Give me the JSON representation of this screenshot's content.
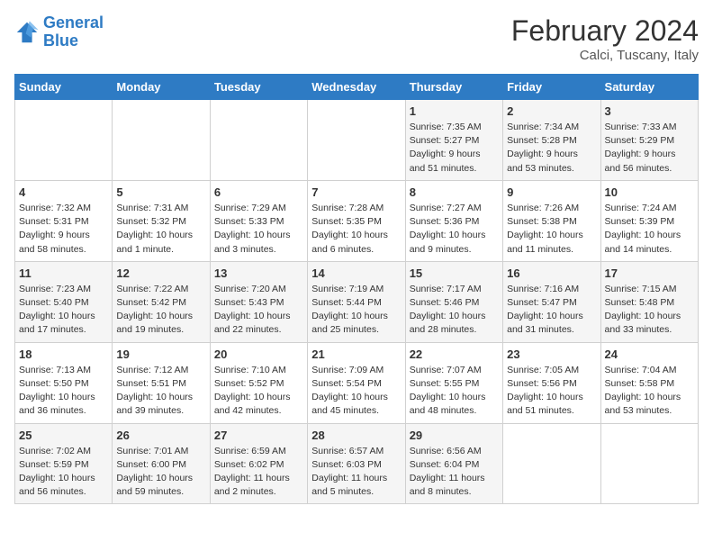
{
  "logo": {
    "line1": "General",
    "line2": "Blue"
  },
  "title": "February 2024",
  "subtitle": "Calci, Tuscany, Italy",
  "days_header": [
    "Sunday",
    "Monday",
    "Tuesday",
    "Wednesday",
    "Thursday",
    "Friday",
    "Saturday"
  ],
  "weeks": [
    [
      {
        "day": "",
        "info": ""
      },
      {
        "day": "",
        "info": ""
      },
      {
        "day": "",
        "info": ""
      },
      {
        "day": "",
        "info": ""
      },
      {
        "day": "1",
        "info": "Sunrise: 7:35 AM\nSunset: 5:27 PM\nDaylight: 9 hours\nand 51 minutes."
      },
      {
        "day": "2",
        "info": "Sunrise: 7:34 AM\nSunset: 5:28 PM\nDaylight: 9 hours\nand 53 minutes."
      },
      {
        "day": "3",
        "info": "Sunrise: 7:33 AM\nSunset: 5:29 PM\nDaylight: 9 hours\nand 56 minutes."
      }
    ],
    [
      {
        "day": "4",
        "info": "Sunrise: 7:32 AM\nSunset: 5:31 PM\nDaylight: 9 hours\nand 58 minutes."
      },
      {
        "day": "5",
        "info": "Sunrise: 7:31 AM\nSunset: 5:32 PM\nDaylight: 10 hours\nand 1 minute."
      },
      {
        "day": "6",
        "info": "Sunrise: 7:29 AM\nSunset: 5:33 PM\nDaylight: 10 hours\nand 3 minutes."
      },
      {
        "day": "7",
        "info": "Sunrise: 7:28 AM\nSunset: 5:35 PM\nDaylight: 10 hours\nand 6 minutes."
      },
      {
        "day": "8",
        "info": "Sunrise: 7:27 AM\nSunset: 5:36 PM\nDaylight: 10 hours\nand 9 minutes."
      },
      {
        "day": "9",
        "info": "Sunrise: 7:26 AM\nSunset: 5:38 PM\nDaylight: 10 hours\nand 11 minutes."
      },
      {
        "day": "10",
        "info": "Sunrise: 7:24 AM\nSunset: 5:39 PM\nDaylight: 10 hours\nand 14 minutes."
      }
    ],
    [
      {
        "day": "11",
        "info": "Sunrise: 7:23 AM\nSunset: 5:40 PM\nDaylight: 10 hours\nand 17 minutes."
      },
      {
        "day": "12",
        "info": "Sunrise: 7:22 AM\nSunset: 5:42 PM\nDaylight: 10 hours\nand 19 minutes."
      },
      {
        "day": "13",
        "info": "Sunrise: 7:20 AM\nSunset: 5:43 PM\nDaylight: 10 hours\nand 22 minutes."
      },
      {
        "day": "14",
        "info": "Sunrise: 7:19 AM\nSunset: 5:44 PM\nDaylight: 10 hours\nand 25 minutes."
      },
      {
        "day": "15",
        "info": "Sunrise: 7:17 AM\nSunset: 5:46 PM\nDaylight: 10 hours\nand 28 minutes."
      },
      {
        "day": "16",
        "info": "Sunrise: 7:16 AM\nSunset: 5:47 PM\nDaylight: 10 hours\nand 31 minutes."
      },
      {
        "day": "17",
        "info": "Sunrise: 7:15 AM\nSunset: 5:48 PM\nDaylight: 10 hours\nand 33 minutes."
      }
    ],
    [
      {
        "day": "18",
        "info": "Sunrise: 7:13 AM\nSunset: 5:50 PM\nDaylight: 10 hours\nand 36 minutes."
      },
      {
        "day": "19",
        "info": "Sunrise: 7:12 AM\nSunset: 5:51 PM\nDaylight: 10 hours\nand 39 minutes."
      },
      {
        "day": "20",
        "info": "Sunrise: 7:10 AM\nSunset: 5:52 PM\nDaylight: 10 hours\nand 42 minutes."
      },
      {
        "day": "21",
        "info": "Sunrise: 7:09 AM\nSunset: 5:54 PM\nDaylight: 10 hours\nand 45 minutes."
      },
      {
        "day": "22",
        "info": "Sunrise: 7:07 AM\nSunset: 5:55 PM\nDaylight: 10 hours\nand 48 minutes."
      },
      {
        "day": "23",
        "info": "Sunrise: 7:05 AM\nSunset: 5:56 PM\nDaylight: 10 hours\nand 51 minutes."
      },
      {
        "day": "24",
        "info": "Sunrise: 7:04 AM\nSunset: 5:58 PM\nDaylight: 10 hours\nand 53 minutes."
      }
    ],
    [
      {
        "day": "25",
        "info": "Sunrise: 7:02 AM\nSunset: 5:59 PM\nDaylight: 10 hours\nand 56 minutes."
      },
      {
        "day": "26",
        "info": "Sunrise: 7:01 AM\nSunset: 6:00 PM\nDaylight: 10 hours\nand 59 minutes."
      },
      {
        "day": "27",
        "info": "Sunrise: 6:59 AM\nSunset: 6:02 PM\nDaylight: 11 hours\nand 2 minutes."
      },
      {
        "day": "28",
        "info": "Sunrise: 6:57 AM\nSunset: 6:03 PM\nDaylight: 11 hours\nand 5 minutes."
      },
      {
        "day": "29",
        "info": "Sunrise: 6:56 AM\nSunset: 6:04 PM\nDaylight: 11 hours\nand 8 minutes."
      },
      {
        "day": "",
        "info": ""
      },
      {
        "day": "",
        "info": ""
      }
    ]
  ]
}
